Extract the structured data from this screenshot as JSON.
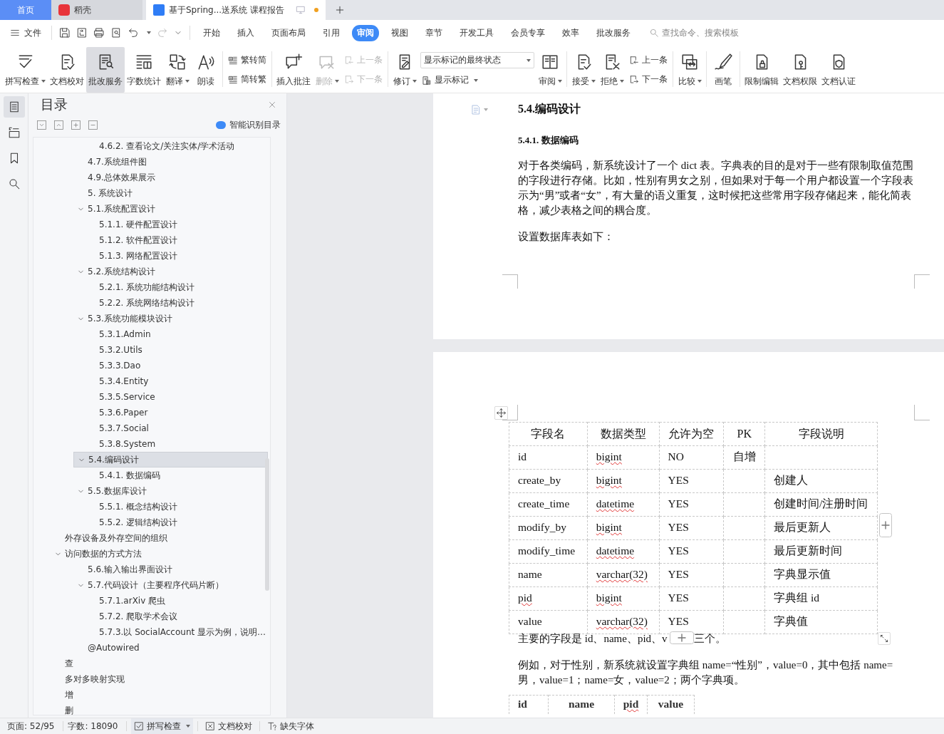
{
  "tabs": [
    {
      "kind": "home",
      "label": "首页",
      "selected": false
    },
    {
      "kind": "app",
      "label": "稻壳",
      "selected": false
    },
    {
      "kind": "document",
      "label": "基于Spring...送系统 课程报告",
      "selected": true,
      "modified": true
    }
  ],
  "menu": {
    "file": "文件",
    "redo_disabled": true,
    "tabs": [
      {
        "label": "开始",
        "selected": false
      },
      {
        "label": "插入",
        "selected": false
      },
      {
        "label": "页面布局",
        "selected": false
      },
      {
        "label": "引用",
        "selected": false
      },
      {
        "label": "审阅",
        "selected": true
      },
      {
        "label": "视图",
        "selected": false
      },
      {
        "label": "章节",
        "selected": false
      },
      {
        "label": "开发工具",
        "selected": false
      },
      {
        "label": "会员专享",
        "selected": false
      },
      {
        "label": "效率",
        "selected": false
      },
      {
        "label": "批改服务",
        "selected": false
      }
    ],
    "search": {
      "placeholder": "查找命令、搜索模板"
    }
  },
  "ribbon": {
    "groups": [
      {
        "items": [
          {
            "kind": "large",
            "label": "拼写检查",
            "dropdown": true,
            "selected": false,
            "disabled": false
          },
          {
            "kind": "large",
            "label": "文档校对",
            "dropdown": false,
            "selected": false,
            "disabled": false
          },
          {
            "kind": "large",
            "label": "批改服务",
            "dropdown": false,
            "selected": true,
            "disabled": false
          },
          {
            "kind": "large",
            "label": "字数统计",
            "dropdown": false,
            "selected": false,
            "disabled": false
          },
          {
            "kind": "large",
            "label": "翻译",
            "dropdown": true,
            "selected": false,
            "disabled": false
          },
          {
            "kind": "large",
            "label": "朗读",
            "dropdown": false,
            "selected": false,
            "disabled": false
          }
        ]
      },
      {
        "items": [
          {
            "kind": "pair",
            "rows": [
              {
                "label": "繁转简",
                "disabled": false
              },
              {
                "label": "简转繁",
                "disabled": false
              }
            ]
          }
        ]
      },
      {
        "items": [
          {
            "kind": "large",
            "label": "插入批注",
            "dropdown": false,
            "selected": false,
            "disabled": false
          },
          {
            "kind": "large",
            "label": "删除",
            "dropdown": true,
            "selected": false,
            "disabled": true
          },
          {
            "kind": "pair",
            "rows": [
              {
                "label": "上一条",
                "disabled": true
              },
              {
                "label": "下一条",
                "disabled": true
              }
            ]
          }
        ]
      },
      {
        "items": [
          {
            "kind": "large",
            "label": "修订",
            "dropdown": true,
            "selected": false,
            "disabled": false
          },
          {
            "kind": "select",
            "value": "显示标记的最终状态",
            "below": {
              "label": "显示标记",
              "dropdown": true
            }
          },
          {
            "kind": "large",
            "label": "审阅",
            "dropdown": true,
            "selected": false,
            "disabled": false
          }
        ]
      },
      {
        "items": [
          {
            "kind": "large",
            "label": "接受",
            "dropdown": true,
            "selected": false,
            "disabled": false
          },
          {
            "kind": "large",
            "label": "拒绝",
            "dropdown": true,
            "selected": false,
            "disabled": false
          },
          {
            "kind": "pair",
            "rows": [
              {
                "label": "上一条",
                "disabled": false
              },
              {
                "label": "下一条",
                "disabled": false
              }
            ]
          }
        ]
      },
      {
        "items": [
          {
            "kind": "large",
            "label": "比较",
            "dropdown": true,
            "selected": false,
            "disabled": false
          }
        ]
      },
      {
        "items": [
          {
            "kind": "large",
            "label": "画笔",
            "dropdown": false,
            "selected": false,
            "disabled": false
          }
        ]
      },
      {
        "items": [
          {
            "kind": "large",
            "label": "限制编辑",
            "dropdown": false,
            "selected": false,
            "disabled": false
          },
          {
            "kind": "large",
            "label": "文档权限",
            "dropdown": false,
            "selected": false,
            "disabled": false
          },
          {
            "kind": "large",
            "label": "文档认证",
            "dropdown": false,
            "selected": false,
            "disabled": false
          }
        ]
      }
    ]
  },
  "sidebar_rail": {
    "items": [
      {
        "selected": true
      },
      {
        "selected": false
      },
      {
        "selected": false
      },
      {
        "selected": false
      }
    ]
  },
  "toc": {
    "title": "目录",
    "smart_button": "智能识别目录",
    "items": [
      {
        "children": [
          {
            "children": [
              {
                "label": "4.6.2. 查看论文/关注实体/学术活动",
                "selected": false
              }
            ]
          },
          {
            "label": "4.7.系统组件图",
            "selected": false
          },
          {
            "label": "4.9.总体效果展示",
            "selected": false
          },
          {
            "label": "5. 系统设计",
            "selected": false
          },
          {
            "label": "5.1.系统配置设计",
            "selected": false,
            "expanded": true,
            "children": [
              {
                "label": "5.1.1. 硬件配置设计",
                "selected": false
              },
              {
                "label": "5.1.2. 软件配置设计",
                "selected": false
              },
              {
                "label": "5.1.3. 网络配置设计",
                "selected": false
              }
            ]
          },
          {
            "label": "5.2.系统结构设计",
            "selected": false,
            "expanded": true,
            "children": [
              {
                "label": "5.2.1. 系统功能结构设计",
                "selected": false
              },
              {
                "label": "5.2.2. 系统网络结构设计",
                "selected": false
              }
            ]
          },
          {
            "label": "5.3.系统功能模块设计",
            "selected": false,
            "expanded": true,
            "children": [
              {
                "label": "5.3.1.Admin",
                "selected": false
              },
              {
                "label": "5.3.2.Utils",
                "selected": false
              },
              {
                "label": "5.3.3.Dao",
                "selected": false
              },
              {
                "label": "5.3.4.Entity",
                "selected": false
              },
              {
                "label": "5.3.5.Service",
                "selected": false
              },
              {
                "label": "5.3.6.Paper",
                "selected": false
              },
              {
                "label": "5.3.7.Social",
                "selected": false
              },
              {
                "label": "5.3.8.System",
                "selected": false
              }
            ]
          },
          {
            "label": "5.4.编码设计",
            "selected": true,
            "expanded": true,
            "children": [
              {
                "label": "5.4.1. 数据编码",
                "selected": false
              }
            ]
          },
          {
            "label": "5.5.数据库设计",
            "selected": false,
            "expanded": true,
            "children": [
              {
                "label": "5.5.1. 概念结构设计",
                "selected": false
              },
              {
                "label": "5.5.2. 逻辑结构设计",
                "selected": false
              }
            ]
          }
        ]
      },
      {
        "label": "外存设备及外存空间的组织",
        "selected": false
      },
      {
        "label": "访问数据的方式方法",
        "selected": false,
        "expanded": true,
        "children": [
          {
            "label": "5.6.输入输出界面设计",
            "selected": false
          },
          {
            "label": "5.7.代码设计（主要程序代码片断）",
            "selected": false,
            "expanded": true,
            "children": [
              {
                "label": "5.7.1.arXiv 爬虫",
                "selected": false
              },
              {
                "label": "5.7.2. 爬取学术会议",
                "selected": false
              },
              {
                "label": "5.7.3.以 SocialAccount 显示为例，说明…",
                "selected": false
              }
            ]
          },
          {
            "label": "@Autowired",
            "selected": false
          }
        ]
      },
      {
        "label": "查",
        "selected": false
      },
      {
        "label": "多对多映射实现",
        "selected": false
      },
      {
        "label": "增",
        "selected": false
      },
      {
        "label": "删",
        "selected": false
      }
    ]
  },
  "document": {
    "heading": "5.4.编码设计",
    "subheading": "5.4.1.  数据编码",
    "paragraph": "对于各类编码，新系统设计了一个 dict 表。字典表的目的是对于一些有限制取值范围的字段进行存储。比如，性别有男女之别，但如果对于每一个用户都设置一个字段表示为“男”或者“女”，有大量的语义重复，这时候把这些常用字段存储起来，能化简表格，减少表格之间的耦合度。",
    "table_intro": "设置数据库表如下：",
    "dict_table": {
      "columns": [
        "字段名",
        "数据类型",
        "允许为空",
        "PK",
        "字段说明"
      ],
      "rows": [
        {
          "cells": [
            {
              "text": "id",
              "misspelled": false
            },
            {
              "text": "bigint",
              "misspelled": true
            },
            {
              "text": "NO",
              "misspelled": false
            },
            {
              "text": "自增",
              "misspelled": false
            },
            {}
          ]
        },
        {
          "cells": [
            {
              "text": "create_by",
              "misspelled": false
            },
            {
              "text": "bigint",
              "misspelled": true
            },
            {
              "text": "YES",
              "misspelled": false
            },
            {},
            {
              "text": "创建人",
              "misspelled": false
            }
          ]
        },
        {
          "cells": [
            {
              "text": "create_time",
              "misspelled": false
            },
            {
              "text": "datetime",
              "misspelled": true
            },
            {
              "text": "YES",
              "misspelled": false
            },
            {},
            {
              "text": "创建时间/注册时间",
              "misspelled": false
            }
          ]
        },
        {
          "cells": [
            {
              "text": "modify_by",
              "misspelled": false
            },
            {
              "text": "bigint",
              "misspelled": true
            },
            {
              "text": "YES",
              "misspelled": false
            },
            {},
            {
              "text": "最后更新人",
              "misspelled": false
            }
          ]
        },
        {
          "cells": [
            {
              "text": "modify_time",
              "misspelled": false
            },
            {
              "text": "datetime",
              "misspelled": true
            },
            {
              "text": "YES",
              "misspelled": false
            },
            {},
            {
              "text": "最后更新时间",
              "misspelled": false
            }
          ]
        },
        {
          "cells": [
            {
              "text": "name",
              "misspelled": false
            },
            {
              "text": "varchar(32)",
              "misspelled": true
            },
            {
              "text": "YES",
              "misspelled": false
            },
            {},
            {
              "text": "字典显示值",
              "misspelled": false
            }
          ]
        },
        {
          "cells": [
            {
              "text": "pid",
              "misspelled": true
            },
            {
              "text": "bigint",
              "misspelled": true
            },
            {
              "text": "YES",
              "misspelled": false
            },
            {},
            {
              "text": "字典组 id",
              "misspelled": false
            }
          ]
        },
        {
          "cells": [
            {
              "text": "value",
              "misspelled": false
            },
            {
              "text": "varchar(32)",
              "misspelled": true
            },
            {
              "text": "YES",
              "misspelled": false
            },
            {},
            {
              "text": "字典值",
              "misspelled": false
            }
          ]
        }
      ]
    },
    "fields_sentence": {
      "before": "主要的字段是 id、name、pid、v",
      "after": "三个。"
    },
    "example": "例如，对于性别，新系统就设置字典组 name=“性别”，value=0，其中包括 name=男，value=1；name=女，value=2；两个字典项。",
    "sample_table": {
      "columns": [
        {
          "text": "id",
          "misspelled": false
        },
        {
          "text": "name",
          "misspelled": false
        },
        {
          "text": "pid",
          "misspelled": true
        },
        {
          "text": "value",
          "misspelled": false
        }
      ]
    }
  },
  "status_bar": {
    "page": "页面: 52/95",
    "words": "字数: 18090",
    "spell_check": {
      "label": "拼写检查",
      "dropdown": true,
      "selected": true
    },
    "proofread": "文档校对",
    "missing_fonts": "缺失字体"
  }
}
